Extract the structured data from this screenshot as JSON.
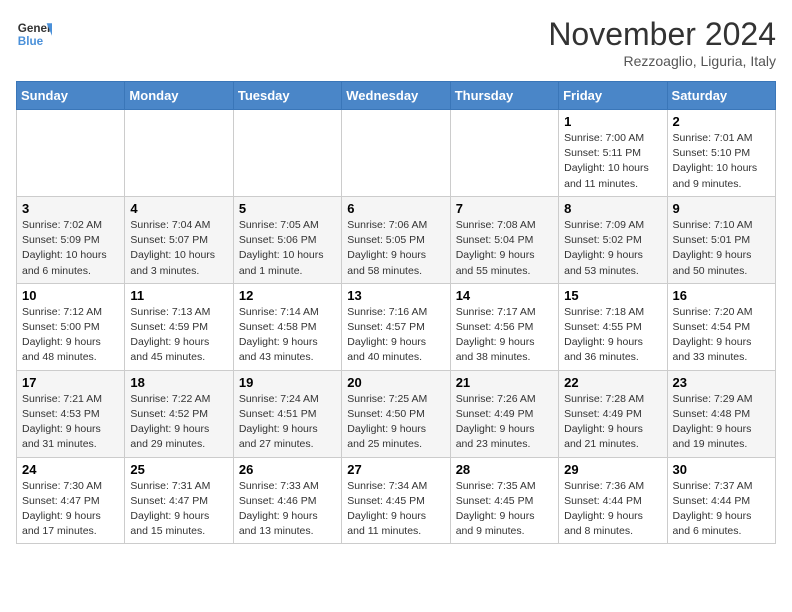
{
  "header": {
    "logo_general": "General",
    "logo_blue": "Blue",
    "title": "November 2024",
    "location": "Rezzoaglio, Liguria, Italy"
  },
  "weekdays": [
    "Sunday",
    "Monday",
    "Tuesday",
    "Wednesday",
    "Thursday",
    "Friday",
    "Saturday"
  ],
  "weeks": [
    [
      {
        "day": "",
        "info": ""
      },
      {
        "day": "",
        "info": ""
      },
      {
        "day": "",
        "info": ""
      },
      {
        "day": "",
        "info": ""
      },
      {
        "day": "",
        "info": ""
      },
      {
        "day": "1",
        "info": "Sunrise: 7:00 AM\nSunset: 5:11 PM\nDaylight: 10 hours and 11 minutes."
      },
      {
        "day": "2",
        "info": "Sunrise: 7:01 AM\nSunset: 5:10 PM\nDaylight: 10 hours and 9 minutes."
      }
    ],
    [
      {
        "day": "3",
        "info": "Sunrise: 7:02 AM\nSunset: 5:09 PM\nDaylight: 10 hours and 6 minutes."
      },
      {
        "day": "4",
        "info": "Sunrise: 7:04 AM\nSunset: 5:07 PM\nDaylight: 10 hours and 3 minutes."
      },
      {
        "day": "5",
        "info": "Sunrise: 7:05 AM\nSunset: 5:06 PM\nDaylight: 10 hours and 1 minute."
      },
      {
        "day": "6",
        "info": "Sunrise: 7:06 AM\nSunset: 5:05 PM\nDaylight: 9 hours and 58 minutes."
      },
      {
        "day": "7",
        "info": "Sunrise: 7:08 AM\nSunset: 5:04 PM\nDaylight: 9 hours and 55 minutes."
      },
      {
        "day": "8",
        "info": "Sunrise: 7:09 AM\nSunset: 5:02 PM\nDaylight: 9 hours and 53 minutes."
      },
      {
        "day": "9",
        "info": "Sunrise: 7:10 AM\nSunset: 5:01 PM\nDaylight: 9 hours and 50 minutes."
      }
    ],
    [
      {
        "day": "10",
        "info": "Sunrise: 7:12 AM\nSunset: 5:00 PM\nDaylight: 9 hours and 48 minutes."
      },
      {
        "day": "11",
        "info": "Sunrise: 7:13 AM\nSunset: 4:59 PM\nDaylight: 9 hours and 45 minutes."
      },
      {
        "day": "12",
        "info": "Sunrise: 7:14 AM\nSunset: 4:58 PM\nDaylight: 9 hours and 43 minutes."
      },
      {
        "day": "13",
        "info": "Sunrise: 7:16 AM\nSunset: 4:57 PM\nDaylight: 9 hours and 40 minutes."
      },
      {
        "day": "14",
        "info": "Sunrise: 7:17 AM\nSunset: 4:56 PM\nDaylight: 9 hours and 38 minutes."
      },
      {
        "day": "15",
        "info": "Sunrise: 7:18 AM\nSunset: 4:55 PM\nDaylight: 9 hours and 36 minutes."
      },
      {
        "day": "16",
        "info": "Sunrise: 7:20 AM\nSunset: 4:54 PM\nDaylight: 9 hours and 33 minutes."
      }
    ],
    [
      {
        "day": "17",
        "info": "Sunrise: 7:21 AM\nSunset: 4:53 PM\nDaylight: 9 hours and 31 minutes."
      },
      {
        "day": "18",
        "info": "Sunrise: 7:22 AM\nSunset: 4:52 PM\nDaylight: 9 hours and 29 minutes."
      },
      {
        "day": "19",
        "info": "Sunrise: 7:24 AM\nSunset: 4:51 PM\nDaylight: 9 hours and 27 minutes."
      },
      {
        "day": "20",
        "info": "Sunrise: 7:25 AM\nSunset: 4:50 PM\nDaylight: 9 hours and 25 minutes."
      },
      {
        "day": "21",
        "info": "Sunrise: 7:26 AM\nSunset: 4:49 PM\nDaylight: 9 hours and 23 minutes."
      },
      {
        "day": "22",
        "info": "Sunrise: 7:28 AM\nSunset: 4:49 PM\nDaylight: 9 hours and 21 minutes."
      },
      {
        "day": "23",
        "info": "Sunrise: 7:29 AM\nSunset: 4:48 PM\nDaylight: 9 hours and 19 minutes."
      }
    ],
    [
      {
        "day": "24",
        "info": "Sunrise: 7:30 AM\nSunset: 4:47 PM\nDaylight: 9 hours and 17 minutes."
      },
      {
        "day": "25",
        "info": "Sunrise: 7:31 AM\nSunset: 4:47 PM\nDaylight: 9 hours and 15 minutes."
      },
      {
        "day": "26",
        "info": "Sunrise: 7:33 AM\nSunset: 4:46 PM\nDaylight: 9 hours and 13 minutes."
      },
      {
        "day": "27",
        "info": "Sunrise: 7:34 AM\nSunset: 4:45 PM\nDaylight: 9 hours and 11 minutes."
      },
      {
        "day": "28",
        "info": "Sunrise: 7:35 AM\nSunset: 4:45 PM\nDaylight: 9 hours and 9 minutes."
      },
      {
        "day": "29",
        "info": "Sunrise: 7:36 AM\nSunset: 4:44 PM\nDaylight: 9 hours and 8 minutes."
      },
      {
        "day": "30",
        "info": "Sunrise: 7:37 AM\nSunset: 4:44 PM\nDaylight: 9 hours and 6 minutes."
      }
    ]
  ]
}
